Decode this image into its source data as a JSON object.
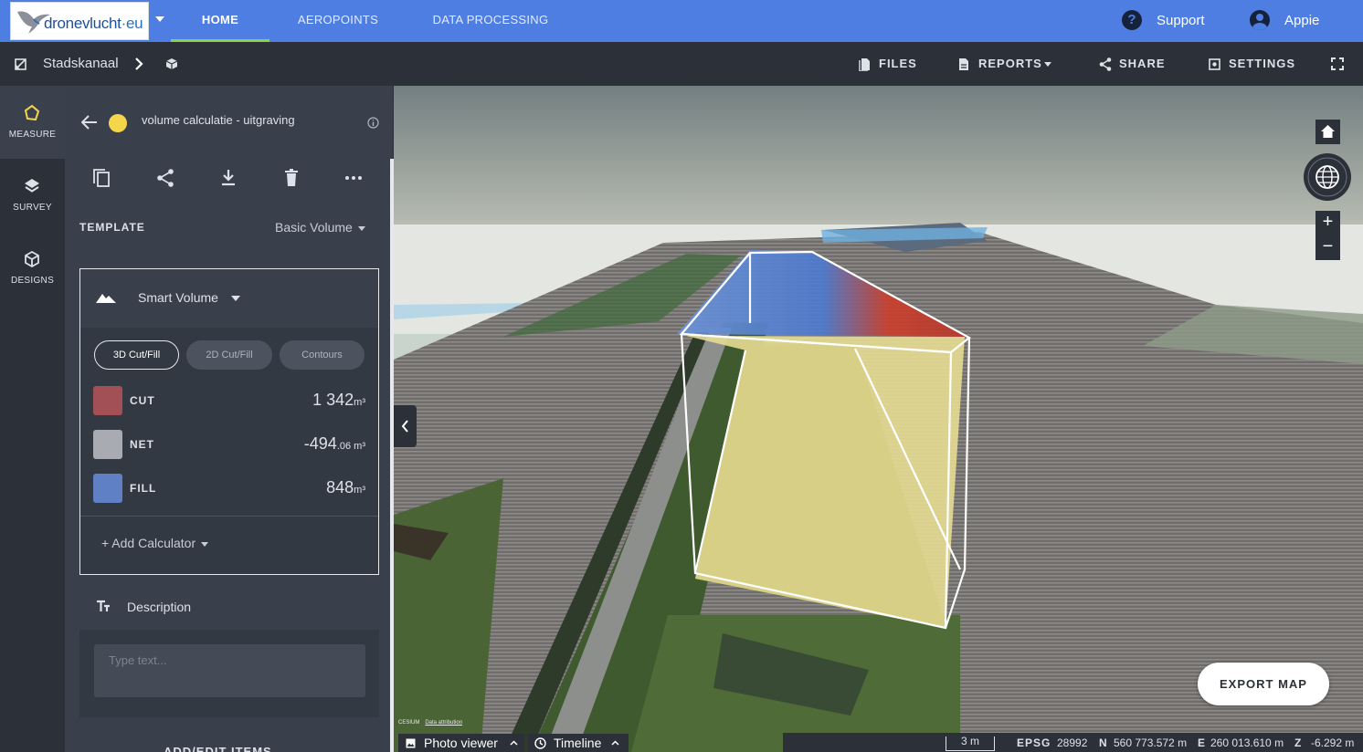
{
  "app": {
    "logo_text": "dronevlucht",
    "logo_suffix": "eu",
    "logo_dot": "·"
  },
  "nav": {
    "tabs": [
      {
        "label": "HOME",
        "active": true
      },
      {
        "label": "AEROPOINTS",
        "active": false
      },
      {
        "label": "DATA PROCESSING",
        "active": false
      }
    ],
    "support_icon": "?",
    "support_label": "Support",
    "user_label": "Appie"
  },
  "breadcrumb": {
    "project": "Stadskanaal",
    "separator_icon": "chevron-right-icon",
    "item_icon": "cube-icon"
  },
  "toolbar": {
    "files": "FILES",
    "reports": "REPORTS",
    "share": "SHARE",
    "settings": "SETTINGS",
    "fullscreen_icon": "fullscreen-icon"
  },
  "rail": [
    {
      "label": "MEASURE",
      "icon": "polygon-icon",
      "active": true
    },
    {
      "label": "SURVEY",
      "icon": "layers-icon",
      "active": false
    },
    {
      "label": "DESIGNS",
      "icon": "cube-icon",
      "active": false
    }
  ],
  "panel": {
    "title": "volume calculatie - uitgraving",
    "dot_color": "#f5d64b",
    "actions": [
      "copy-icon",
      "share-icon",
      "download-icon",
      "delete-icon",
      "more-icon"
    ],
    "template_label": "TEMPLATE",
    "template_value": "Basic Volume",
    "calculator": {
      "title": "Smart Volume",
      "modes": [
        {
          "label": "3D Cut/Fill",
          "active": true
        },
        {
          "label": "2D Cut/Fill",
          "active": false
        },
        {
          "label": "Contours",
          "active": false
        }
      ],
      "rows": [
        {
          "key": "CUT",
          "value": "1 342",
          "unit": "m³",
          "color": "#a24f55"
        },
        {
          "key": "NET",
          "value": "-494",
          "decimals": ".06",
          "unit": " m³",
          "color": "#a8abb1"
        },
        {
          "key": "FILL",
          "value": "848",
          "unit": "m³",
          "color": "#5f80c4"
        }
      ],
      "add_label": "+ Add Calculator"
    },
    "description": {
      "title": "Description",
      "placeholder": "Type text..."
    },
    "add_items_label": "ADD/EDIT ITEMS"
  },
  "map": {
    "export_label": "EXPORT MAP",
    "cesium_label": "CESIUM",
    "attribution_label": "Data attribution",
    "photo_viewer_label": "Photo viewer",
    "timeline_label": "Timeline",
    "scale_label": "3 m",
    "crs_label": "EPSG",
    "crs_value": "28992",
    "n_label": "N",
    "n_value": "560 773.572 m",
    "e_label": "E",
    "e_value": "260 013.610 m",
    "z_label": "Z",
    "z_value": "-6.292 m",
    "zoom_in": "+",
    "zoom_out": "−"
  }
}
